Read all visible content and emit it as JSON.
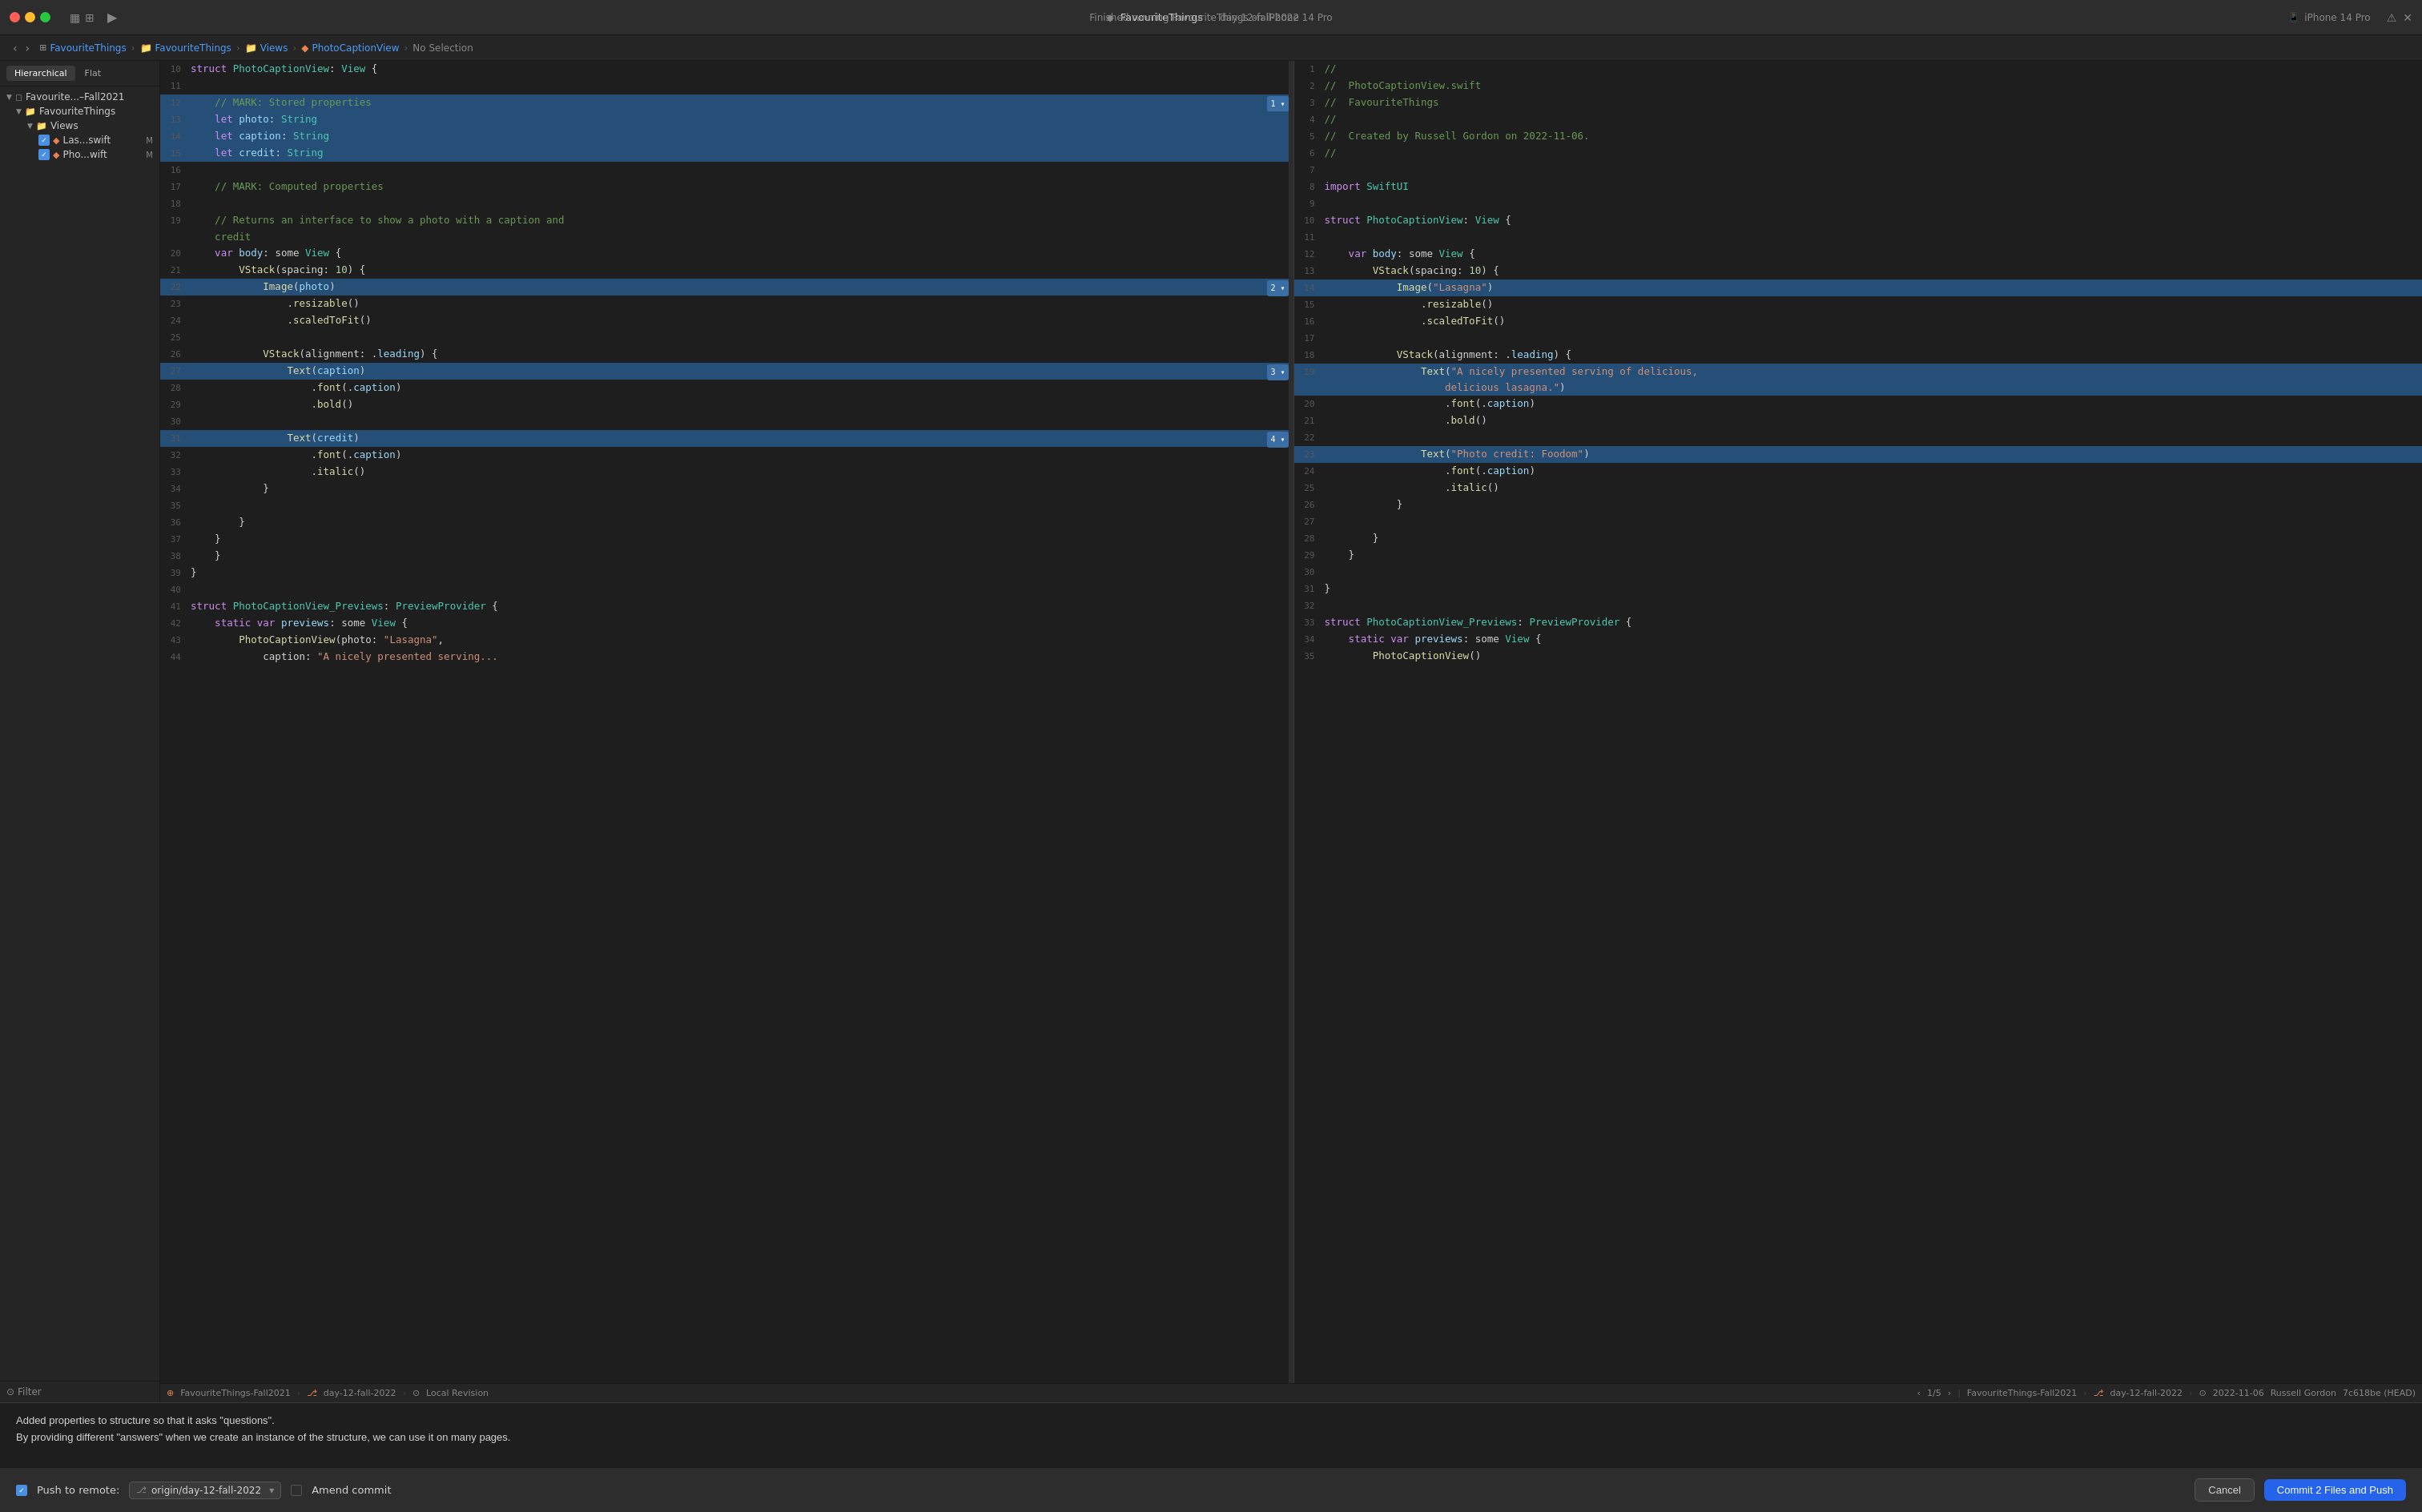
{
  "titlebar": {
    "app_name": "FavouriteThings",
    "subtitle": "day-12-fall-2022",
    "run_status": "Finished running FavouriteThings on iPhone 14 Pro",
    "device": "iPhone 14 Pro"
  },
  "breadcrumb": {
    "items": [
      "FavouriteThings",
      "FavouriteThings",
      "Views",
      "PhotoCaptionView",
      "No Selection"
    ]
  },
  "sidebar": {
    "tab_hierarchical": "Hierarchical",
    "tab_flat": "Flat",
    "tree": [
      {
        "label": "Favourite...–Fall2021",
        "level": 1,
        "type": "project"
      },
      {
        "label": "FavouriteThings",
        "level": 2,
        "type": "folder"
      },
      {
        "label": "Views",
        "level": 3,
        "type": "folder"
      },
      {
        "label": "Las...swift",
        "level": 4,
        "type": "swift",
        "badge": "M",
        "checked": true
      },
      {
        "label": "Pho...wift",
        "level": 4,
        "type": "swift",
        "badge": "M",
        "checked": true
      }
    ],
    "filter_placeholder": "Filter"
  },
  "left_pane": {
    "status_left": "FavouriteThings-Fall2021",
    "branch": "day-12-fall-2022",
    "revision": "Local Revision",
    "page": "1/5",
    "lines": [
      {
        "num": 10,
        "content": "struct PhotoCaptionView: View {",
        "highlighted": false
      },
      {
        "num": 11,
        "content": "",
        "highlighted": false
      },
      {
        "num": 12,
        "content": "    // MARK: Stored properties",
        "highlighted": true,
        "type": "comment-block"
      },
      {
        "num": 13,
        "content": "    let photo: String",
        "highlighted": true
      },
      {
        "num": 14,
        "content": "    let caption: String",
        "highlighted": true
      },
      {
        "num": 15,
        "content": "    let credit: String",
        "highlighted": true
      },
      {
        "num": 16,
        "content": "",
        "highlighted": false
      },
      {
        "num": 17,
        "content": "    // MARK: Computed properties",
        "highlighted": false
      },
      {
        "num": 18,
        "content": "",
        "highlighted": false
      },
      {
        "num": 19,
        "content": "    // Returns an interface to show a photo with a caption and credit",
        "highlighted": false
      },
      {
        "num": 20,
        "content": "    var body: some View {",
        "highlighted": false
      },
      {
        "num": 21,
        "content": "        VStack(spacing: 10) {",
        "highlighted": false
      },
      {
        "num": 22,
        "content": "            Image(photo)",
        "highlighted": true,
        "diff": "2"
      },
      {
        "num": 23,
        "content": "                .resizable()",
        "highlighted": false
      },
      {
        "num": 24,
        "content": "                .scaledToFit()",
        "highlighted": false
      },
      {
        "num": 25,
        "content": "",
        "highlighted": false
      },
      {
        "num": 26,
        "content": "            VStack(alignment: .leading) {",
        "highlighted": false
      },
      {
        "num": 27,
        "content": "                Text(caption)",
        "highlighted": true,
        "diff": "3"
      },
      {
        "num": 28,
        "content": "                    .font(.caption)",
        "highlighted": false
      },
      {
        "num": 29,
        "content": "                    .bold()",
        "highlighted": false
      },
      {
        "num": 30,
        "content": "",
        "highlighted": false
      },
      {
        "num": 31,
        "content": "                Text(credit)",
        "highlighted": true,
        "diff": "4"
      },
      {
        "num": 32,
        "content": "                    .font(.caption)",
        "highlighted": false
      },
      {
        "num": 33,
        "content": "                    .italic()",
        "highlighted": false
      },
      {
        "num": 34,
        "content": "            }",
        "highlighted": false
      },
      {
        "num": 35,
        "content": "",
        "highlighted": false
      },
      {
        "num": 36,
        "content": "        }",
        "highlighted": false
      },
      {
        "num": 37,
        "content": "    }",
        "highlighted": false
      },
      {
        "num": 38,
        "content": "    }",
        "highlighted": false
      },
      {
        "num": 39,
        "content": "}",
        "highlighted": false
      },
      {
        "num": 40,
        "content": "",
        "highlighted": false
      },
      {
        "num": 41,
        "content": "struct PhotoCaptionView_Previews: PreviewProvider {",
        "highlighted": false
      },
      {
        "num": 42,
        "content": "    static var previews: some View {",
        "highlighted": false
      },
      {
        "num": 43,
        "content": "        PhotoCaptionView(photo: \"Lasagna\",",
        "highlighted": false
      },
      {
        "num": 44,
        "content": "            caption: \"A nicely presented serving...",
        "highlighted": false
      }
    ]
  },
  "right_pane": {
    "status_left": "FavouriteThings-Fall2021",
    "branch": "day-12-fall-2022",
    "revision": "2022-11-06",
    "author": "Russell Gordon",
    "commit": "7c618be (HEAD)",
    "lines": [
      {
        "num": 1,
        "content": "//"
      },
      {
        "num": 2,
        "content": "//  PhotoCaptionView.swift"
      },
      {
        "num": 3,
        "content": "//  FavouriteThings"
      },
      {
        "num": 4,
        "content": "//"
      },
      {
        "num": 5,
        "content": "//  Created by Russell Gordon on 2022-11-06."
      },
      {
        "num": 6,
        "content": "//"
      },
      {
        "num": 7,
        "content": ""
      },
      {
        "num": 8,
        "content": "import SwiftUI"
      },
      {
        "num": 9,
        "content": ""
      },
      {
        "num": 10,
        "content": "struct PhotoCaptionView: View {"
      },
      {
        "num": 11,
        "content": ""
      },
      {
        "num": 12,
        "content": "    var body: some View {",
        "highlighted": false
      },
      {
        "num": 13,
        "content": "        VStack(spacing: 10) {",
        "highlighted": false
      },
      {
        "num": 14,
        "content": "            Image(\"Lasagna\")",
        "highlighted": true
      },
      {
        "num": 15,
        "content": "                .resizable()"
      },
      {
        "num": 16,
        "content": "                .scaledToFit()"
      },
      {
        "num": 17,
        "content": ""
      },
      {
        "num": 18,
        "content": "            VStack(alignment: .leading) {"
      },
      {
        "num": 19,
        "content": "                Text(\"A nicely presented serving of delicious, delicious lasagna.\")",
        "highlighted": true
      },
      {
        "num": 20,
        "content": "                    .font(.caption)"
      },
      {
        "num": 21,
        "content": "                    .bold()"
      },
      {
        "num": 22,
        "content": ""
      },
      {
        "num": 23,
        "content": "                Text(\"Photo credit: Foodom\")",
        "highlighted": true
      },
      {
        "num": 24,
        "content": "                    .font(.caption)"
      },
      {
        "num": 25,
        "content": "                    .italic()"
      },
      {
        "num": 26,
        "content": "            }"
      },
      {
        "num": 27,
        "content": ""
      },
      {
        "num": 28,
        "content": "        }"
      },
      {
        "num": 29,
        "content": "    }"
      },
      {
        "num": 30,
        "content": ""
      },
      {
        "num": 31,
        "content": "}"
      },
      {
        "num": 32,
        "content": ""
      },
      {
        "num": 33,
        "content": "struct PhotoCaptionView_Previews: PreviewProvider {"
      },
      {
        "num": 34,
        "content": "    static var previews: some View {"
      },
      {
        "num": 35,
        "content": "        PhotoCaptionView()"
      }
    ]
  },
  "commit_messages": [
    "Added properties to structure so that it asks \"questions\".",
    "By providing different \"answers\" when we create an instance of the structure, we can use it on many pages."
  ],
  "commit_toolbar": {
    "push_label": "Push to remote:",
    "branch_name": "origin/day-12-fall-2022",
    "amend_label": "Amend commit",
    "cancel_label": "Cancel",
    "commit_label": "Commit 2 Files and Push"
  }
}
